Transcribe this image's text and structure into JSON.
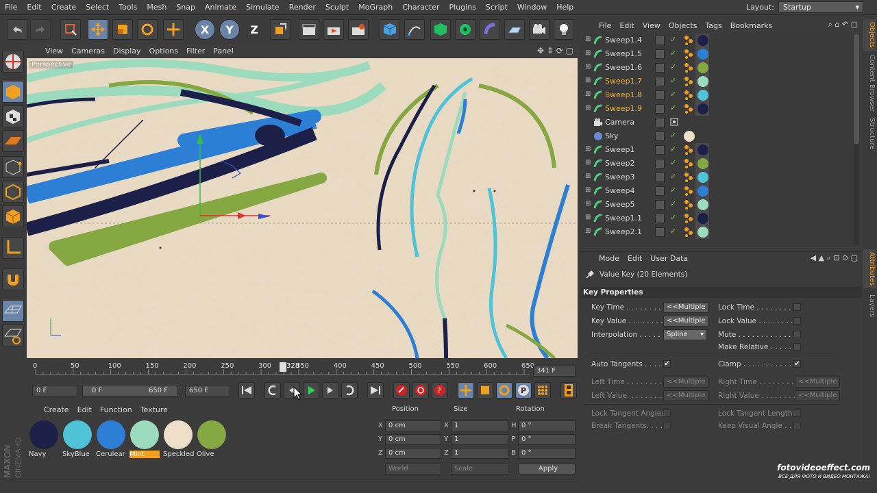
{
  "menubar": {
    "items": [
      "File",
      "Edit",
      "Create",
      "Select",
      "Tools",
      "Mesh",
      "Snap",
      "Animate",
      "Simulate",
      "Render",
      "Sculpt",
      "MoGraph",
      "Character",
      "Plugins",
      "Script",
      "Window",
      "Help"
    ],
    "layout_label": "Layout:",
    "layout_value": "Startup"
  },
  "toolbar": {
    "axis_x": "X",
    "axis_y": "Y",
    "axis_z": "Z"
  },
  "viewport": {
    "menu": [
      "View",
      "Cameras",
      "Display",
      "Options",
      "Filter",
      "Panel"
    ],
    "label": "Perspective"
  },
  "timeline": {
    "ticks": [
      "0",
      "50",
      "100",
      "150",
      "200",
      "250",
      "300",
      "350",
      "400",
      "450",
      "500",
      "550",
      "600",
      "650"
    ],
    "current_marker": "328",
    "frame_field": "341 F"
  },
  "transport": {
    "start": "0 F",
    "range_start": "0 F",
    "range_end": "650 F",
    "end": "650 F"
  },
  "materials": {
    "menu": [
      "Create",
      "Edit",
      "Function",
      "Texture"
    ],
    "items": [
      {
        "name": "Navy",
        "color": "#1c2048",
        "selected": false
      },
      {
        "name": "SkyBlue",
        "color": "#4fc3d8",
        "selected": false
      },
      {
        "name": "Cerulear",
        "color": "#2d7fd6",
        "selected": false
      },
      {
        "name": "Mint",
        "color": "#9ddbbf",
        "selected": true
      },
      {
        "name": "Speckled",
        "color": "#eedfc8",
        "selected": false
      },
      {
        "name": "Olive",
        "color": "#86a843",
        "selected": false
      }
    ]
  },
  "coords": {
    "headers": [
      "Position",
      "Size",
      "Rotation"
    ],
    "x_label": "X",
    "y_label": "Y",
    "z_label": "Z",
    "h_label": "H",
    "p_label": "P",
    "b_label": "B",
    "pos_x": "0 cm",
    "pos_y": "0 cm",
    "pos_z": "0 cm",
    "size_x": "1",
    "size_y": "1",
    "size_z": "1",
    "rot_h": "0 °",
    "rot_p": "0 °",
    "rot_b": "0 °",
    "mode1": "World",
    "mode2": "Scale",
    "apply": "Apply"
  },
  "objects": {
    "menu": [
      "File",
      "Edit",
      "View",
      "Objects",
      "Tags",
      "Bookmarks"
    ],
    "rows": [
      {
        "name": "Sweep1.4",
        "type": "sweep",
        "color": "#1c2048",
        "hl": false
      },
      {
        "name": "Sweep1.5",
        "type": "sweep",
        "color": "#2d7fd6",
        "hl": false
      },
      {
        "name": "Sweep1.6",
        "type": "sweep",
        "color": "#86a843",
        "hl": false
      },
      {
        "name": "Sweep1.7",
        "type": "sweep",
        "color": "#9ddbbf",
        "hl": true
      },
      {
        "name": "Sweep1.8",
        "type": "sweep",
        "color": "#4fc3d8",
        "hl": true
      },
      {
        "name": "Sweep1.9",
        "type": "sweep",
        "color": "#1c2048",
        "hl": true
      },
      {
        "name": "Camera",
        "type": "camera",
        "color": "",
        "hl": false
      },
      {
        "name": "Sky",
        "type": "sky",
        "color": "#eedfc8",
        "hl": false
      },
      {
        "name": "Sweep1",
        "type": "sweep",
        "color": "#1c2048",
        "hl": false
      },
      {
        "name": "Sweep2",
        "type": "sweep",
        "color": "#86a843",
        "hl": false
      },
      {
        "name": "Sweep3",
        "type": "sweep",
        "color": "#4fc3d8",
        "hl": false
      },
      {
        "name": "Sweep4",
        "type": "sweep",
        "color": "#2d7fd6",
        "hl": false
      },
      {
        "name": "Sweep5",
        "type": "sweep",
        "color": "#9ddbbf",
        "hl": false
      },
      {
        "name": "Sweep1.1",
        "type": "sweep",
        "color": "#1c2048",
        "hl": false
      },
      {
        "name": "Sweep2.1",
        "type": "sweep",
        "color": "#9ddbbf",
        "hl": false
      }
    ]
  },
  "attributes": {
    "menu": [
      "Mode",
      "Edit",
      "User Data"
    ],
    "title": "Value Key (20 Elements)",
    "section": "Key Properties",
    "key_time_label": "Key Time . . . . . . . .",
    "key_time_value": "<<Multiple",
    "key_value_label": "Key Value . . . . . . . .",
    "key_value_value": "<<Multiple",
    "interpolation_label": "Interpolation . . . . .",
    "interpolation_value": "Spline",
    "lock_time_label": "Lock Time . . . . . . . . . .",
    "lock_value_label": "Lock Value . . . . . . . . .",
    "mute_label": "Mute . . . . . . . . . . . . . .",
    "make_relative_label": "Make Relative . . . . . .",
    "auto_tangents_label": "Auto Tangents . . . .",
    "clamp_label": "Clamp . . . . . . . . . . . . .",
    "left_time_label": "Left  Time . . . . . . . .",
    "left_time_value": "<<Multiple",
    "right_time_label": "Right Time . . . . . . . . . .",
    "right_time_value": "<<Multiple",
    "left_value_label": "Left  Value. . . . . . . .",
    "left_value_value": "<<Multiple",
    "right_value_label": "Right Value . . . . . . . . . .",
    "right_value_value": "<<Multiple",
    "lock_tangent_angles_label": "Lock Tangent Angles",
    "lock_tangent_lengths_label": "Lock Tangent Lengths",
    "break_tangents_label": "Break Tangents. . . .",
    "keep_visual_angle_label": "Keep Visual Angle . . . ."
  },
  "sidetabs": {
    "top": [
      "Objects",
      "Content Browser",
      "Structure"
    ],
    "bottom": [
      "Attributes",
      "Layers"
    ]
  },
  "branding": {
    "maxon": "MAXON",
    "cinema": "CINEMA 4D"
  },
  "watermark": {
    "line1": "fotovideoeffect.com",
    "line2": "ВСЕ ДЛЯ ФОТО И ВИДЕО МОНТАЖА!"
  }
}
